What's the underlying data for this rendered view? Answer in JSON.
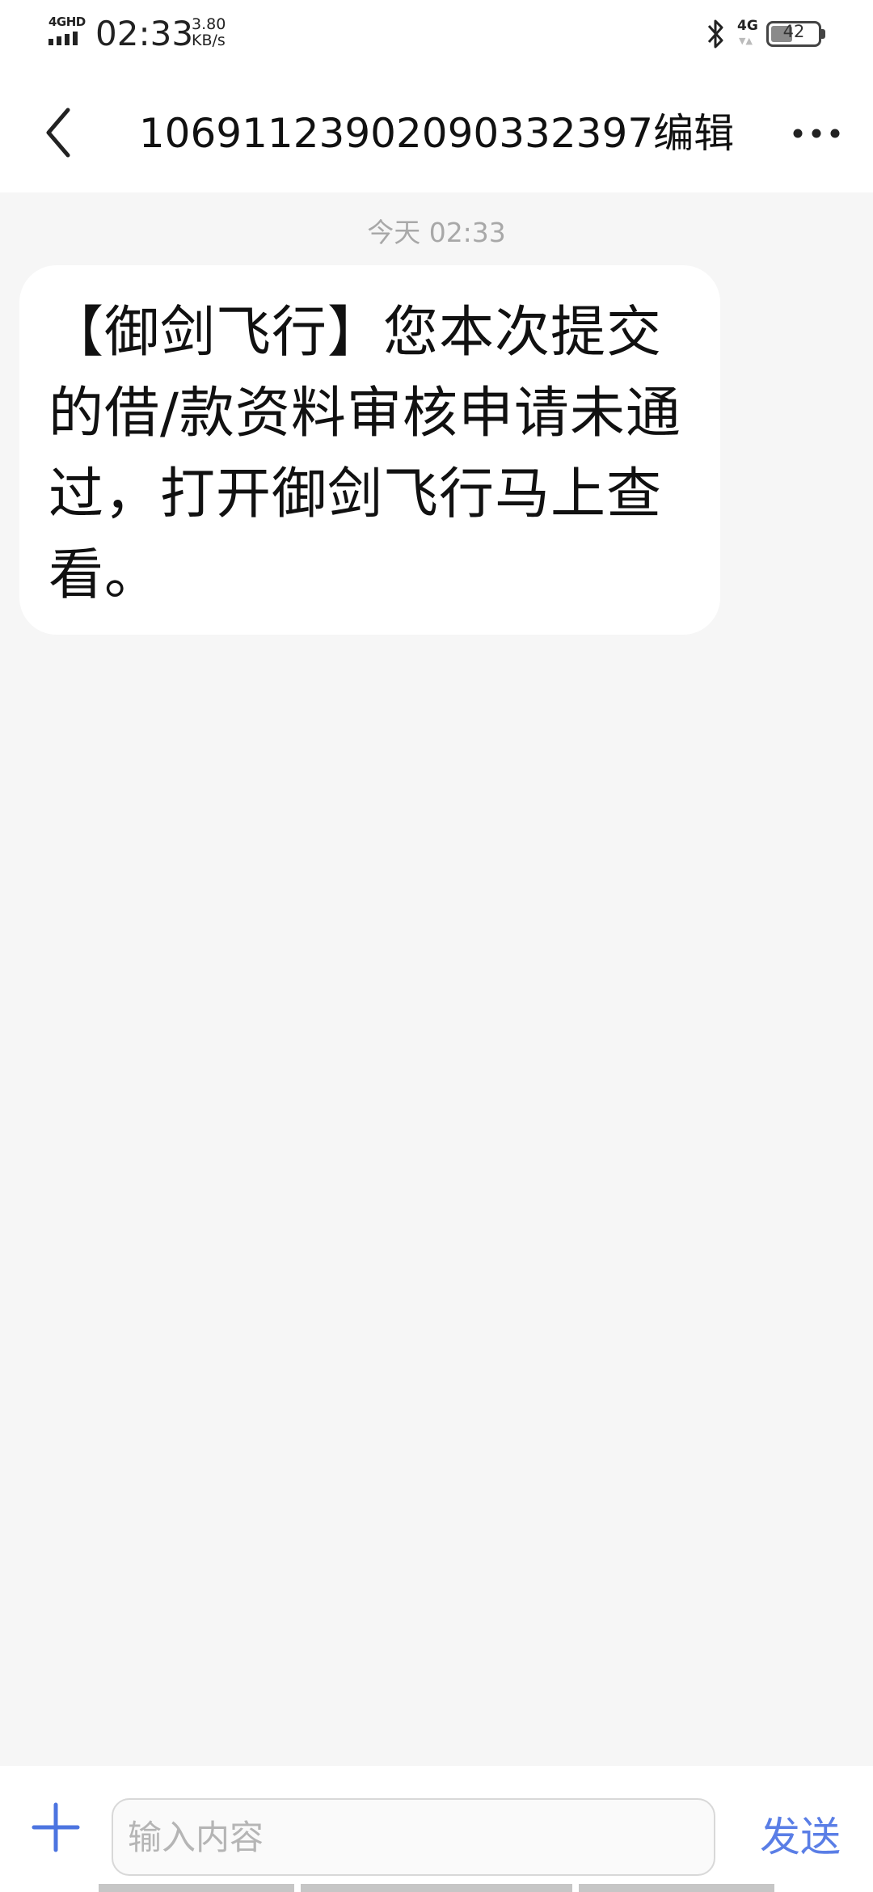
{
  "status_bar": {
    "network_label": "4GHD",
    "time": "02:33",
    "speed_value": "3.80",
    "speed_unit": "KB/s",
    "network_type": "4G",
    "battery_level": "42",
    "icons": [
      "signal-icon",
      "bluetooth-icon",
      "battery-icon"
    ]
  },
  "header": {
    "title": "106911239020903323​97编辑",
    "icons": [
      "back-arrow-icon",
      "more-icon"
    ]
  },
  "thread": {
    "date": "今天 02:33",
    "message": "【御剑飞行】您本次提交的借/款资料审核申请未通过，打开御剑飞行马上查看。"
  },
  "composer": {
    "placeholder": "输入内容",
    "value": "",
    "send_label": "发送",
    "icons": [
      "plus-icon"
    ]
  },
  "colors": {
    "accent": "#5a7ee6",
    "background": "#f6f6f6",
    "bubble": "#ffffff"
  }
}
